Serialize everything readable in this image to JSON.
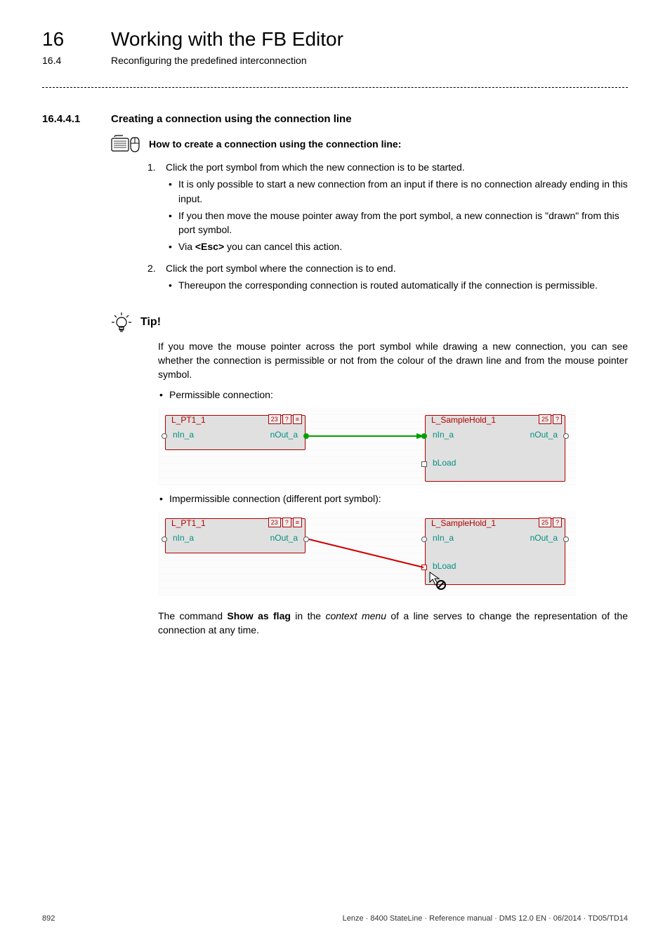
{
  "chapter": {
    "number": "16",
    "title": "Working with the FB Editor"
  },
  "section": {
    "number": "16.4",
    "title": "Reconfiguring the predefined interconnection"
  },
  "subsection": {
    "number": "16.4.4.1",
    "title": "Creating a connection using the connection line"
  },
  "howto": {
    "text": "How to create a connection using the connection line:"
  },
  "steps": {
    "step1": "Click the port symbol from which the new connection is to be started.",
    "step1_sub1": "It is only possible to start a new connection from an input if there is no connection already ending in this input.",
    "step1_sub2": "If you then move the mouse pointer away from the port symbol, a new connection is \"drawn\" from this port symbol.",
    "step1_sub3_prefix": "Via ",
    "step1_sub3_key": "<Esc>",
    "step1_sub3_suffix": " you can cancel this action.",
    "step2": "Click the port symbol where the connection is to end.",
    "step2_sub1": "Thereupon the corresponding connection is routed automatically if the connection is permissible."
  },
  "tip": {
    "label": "Tip!",
    "body": "If you move the mouse pointer across the port symbol while drawing a new connection, you can see whether the connection is permissible or not from the colour of the drawn line and from the mouse pointer symbol.",
    "permissible": "Permissible connection:",
    "impermissible": "Impermissible connection (different port symbol):"
  },
  "diagram": {
    "block1_title": "L_PT1_1",
    "block1_badge1": "23",
    "block1_badge2": "?",
    "block1_badge3": "≡",
    "block1_in": "nIn_a",
    "block1_out": "nOut_a",
    "block2_title": "L_SampleHold_1",
    "block2_badge1": "25",
    "block2_badge2": "?",
    "block2_in": "nIn_a",
    "block2_out": "nOut_a",
    "block2_load": "bLoad"
  },
  "footer_paragraph": {
    "prefix": "The command ",
    "cmd": "Show as flag",
    "mid": " in the ",
    "menu": "context menu",
    "suffix": " of a line serves to change the representation of the connection at any time."
  },
  "page_footer": {
    "page": "892",
    "doc": "Lenze · 8400 StateLine · Reference manual · DMS 12.0 EN · 06/2014 · TD05/TD14"
  }
}
